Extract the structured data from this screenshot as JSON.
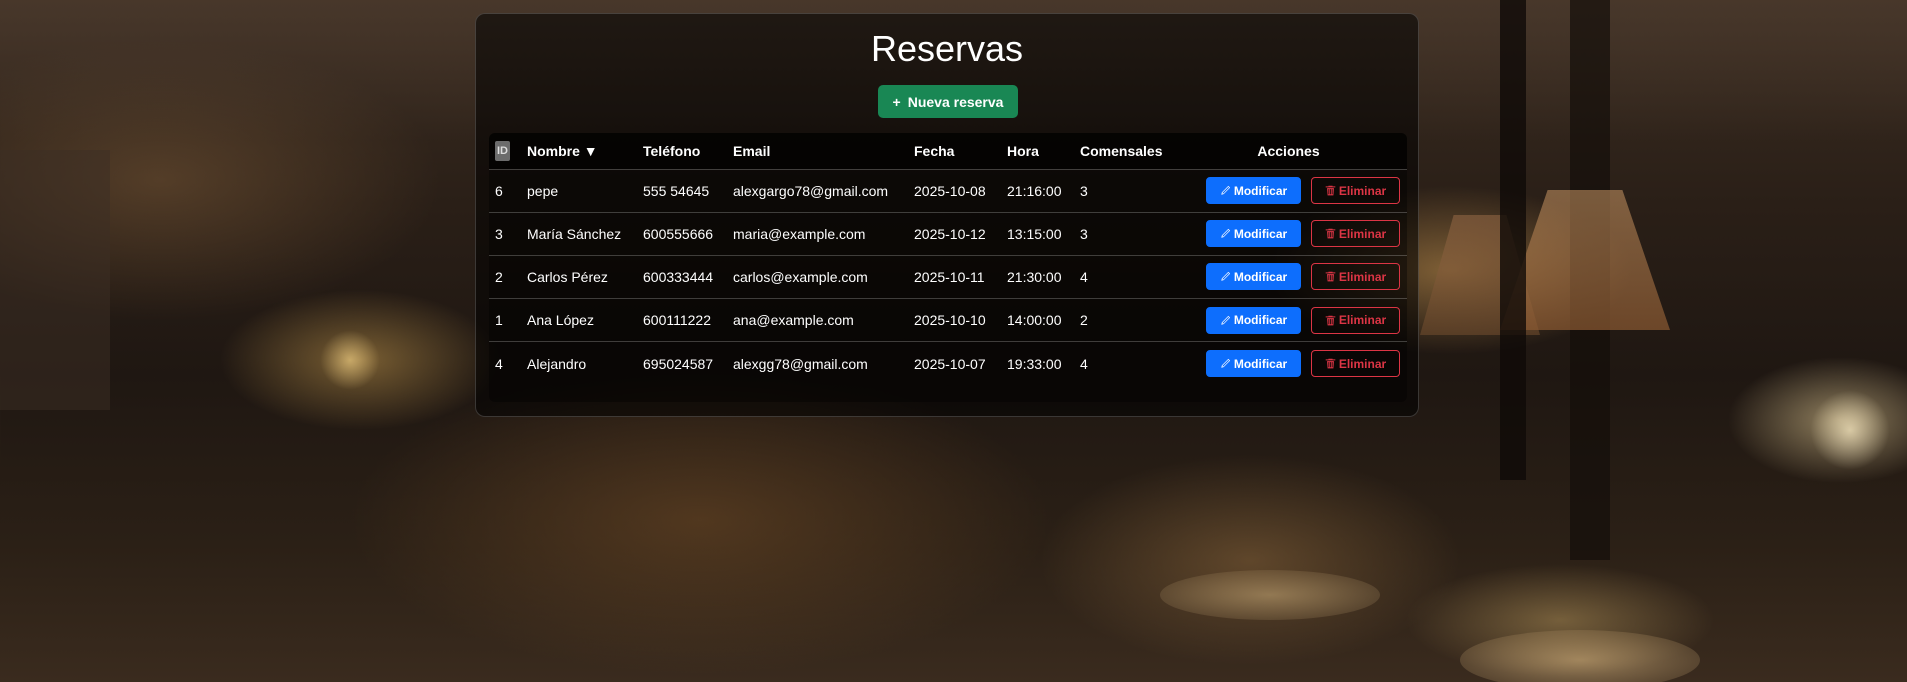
{
  "page": {
    "title": "Reservas",
    "new_button_label": "Nueva reserva",
    "new_button_icon": "plus-icon"
  },
  "table": {
    "headers": {
      "id": "ID",
      "nombre": "Nombre ▼",
      "telefono": "Teléfono",
      "email": "Email",
      "fecha": "Fecha",
      "hora": "Hora",
      "comensales": "Comensales",
      "acciones": "Acciones"
    },
    "rows": [
      {
        "id": "6",
        "nombre": "pepe",
        "telefono": "555 54645",
        "email": "alexgargo78@gmail.com",
        "fecha": "2025-10-08",
        "hora": "21:16:00",
        "comensales": "3"
      },
      {
        "id": "3",
        "nombre": "María Sánchez",
        "telefono": "600555666",
        "email": "maria@example.com",
        "fecha": "2025-10-12",
        "hora": "13:15:00",
        "comensales": "3"
      },
      {
        "id": "2",
        "nombre": "Carlos Pérez",
        "telefono": "600333444",
        "email": "carlos@example.com",
        "fecha": "2025-10-11",
        "hora": "21:30:00",
        "comensales": "4"
      },
      {
        "id": "1",
        "nombre": "Ana López",
        "telefono": "600111222",
        "email": "ana@example.com",
        "fecha": "2025-10-10",
        "hora": "14:00:00",
        "comensales": "2"
      },
      {
        "id": "4",
        "nombre": "Alejandro",
        "telefono": "695024587",
        "email": "alexgg78@gmail.com",
        "fecha": "2025-10-07",
        "hora": "19:33:00",
        "comensales": "4"
      }
    ],
    "actions": {
      "modify_label": "Modificar",
      "modify_icon": "pencil-icon",
      "delete_label": "Eliminar",
      "delete_icon": "trash-icon"
    }
  },
  "colors": {
    "new_button": "#198754",
    "modify_button": "#0d6efd",
    "delete_button": "#dc3545"
  }
}
